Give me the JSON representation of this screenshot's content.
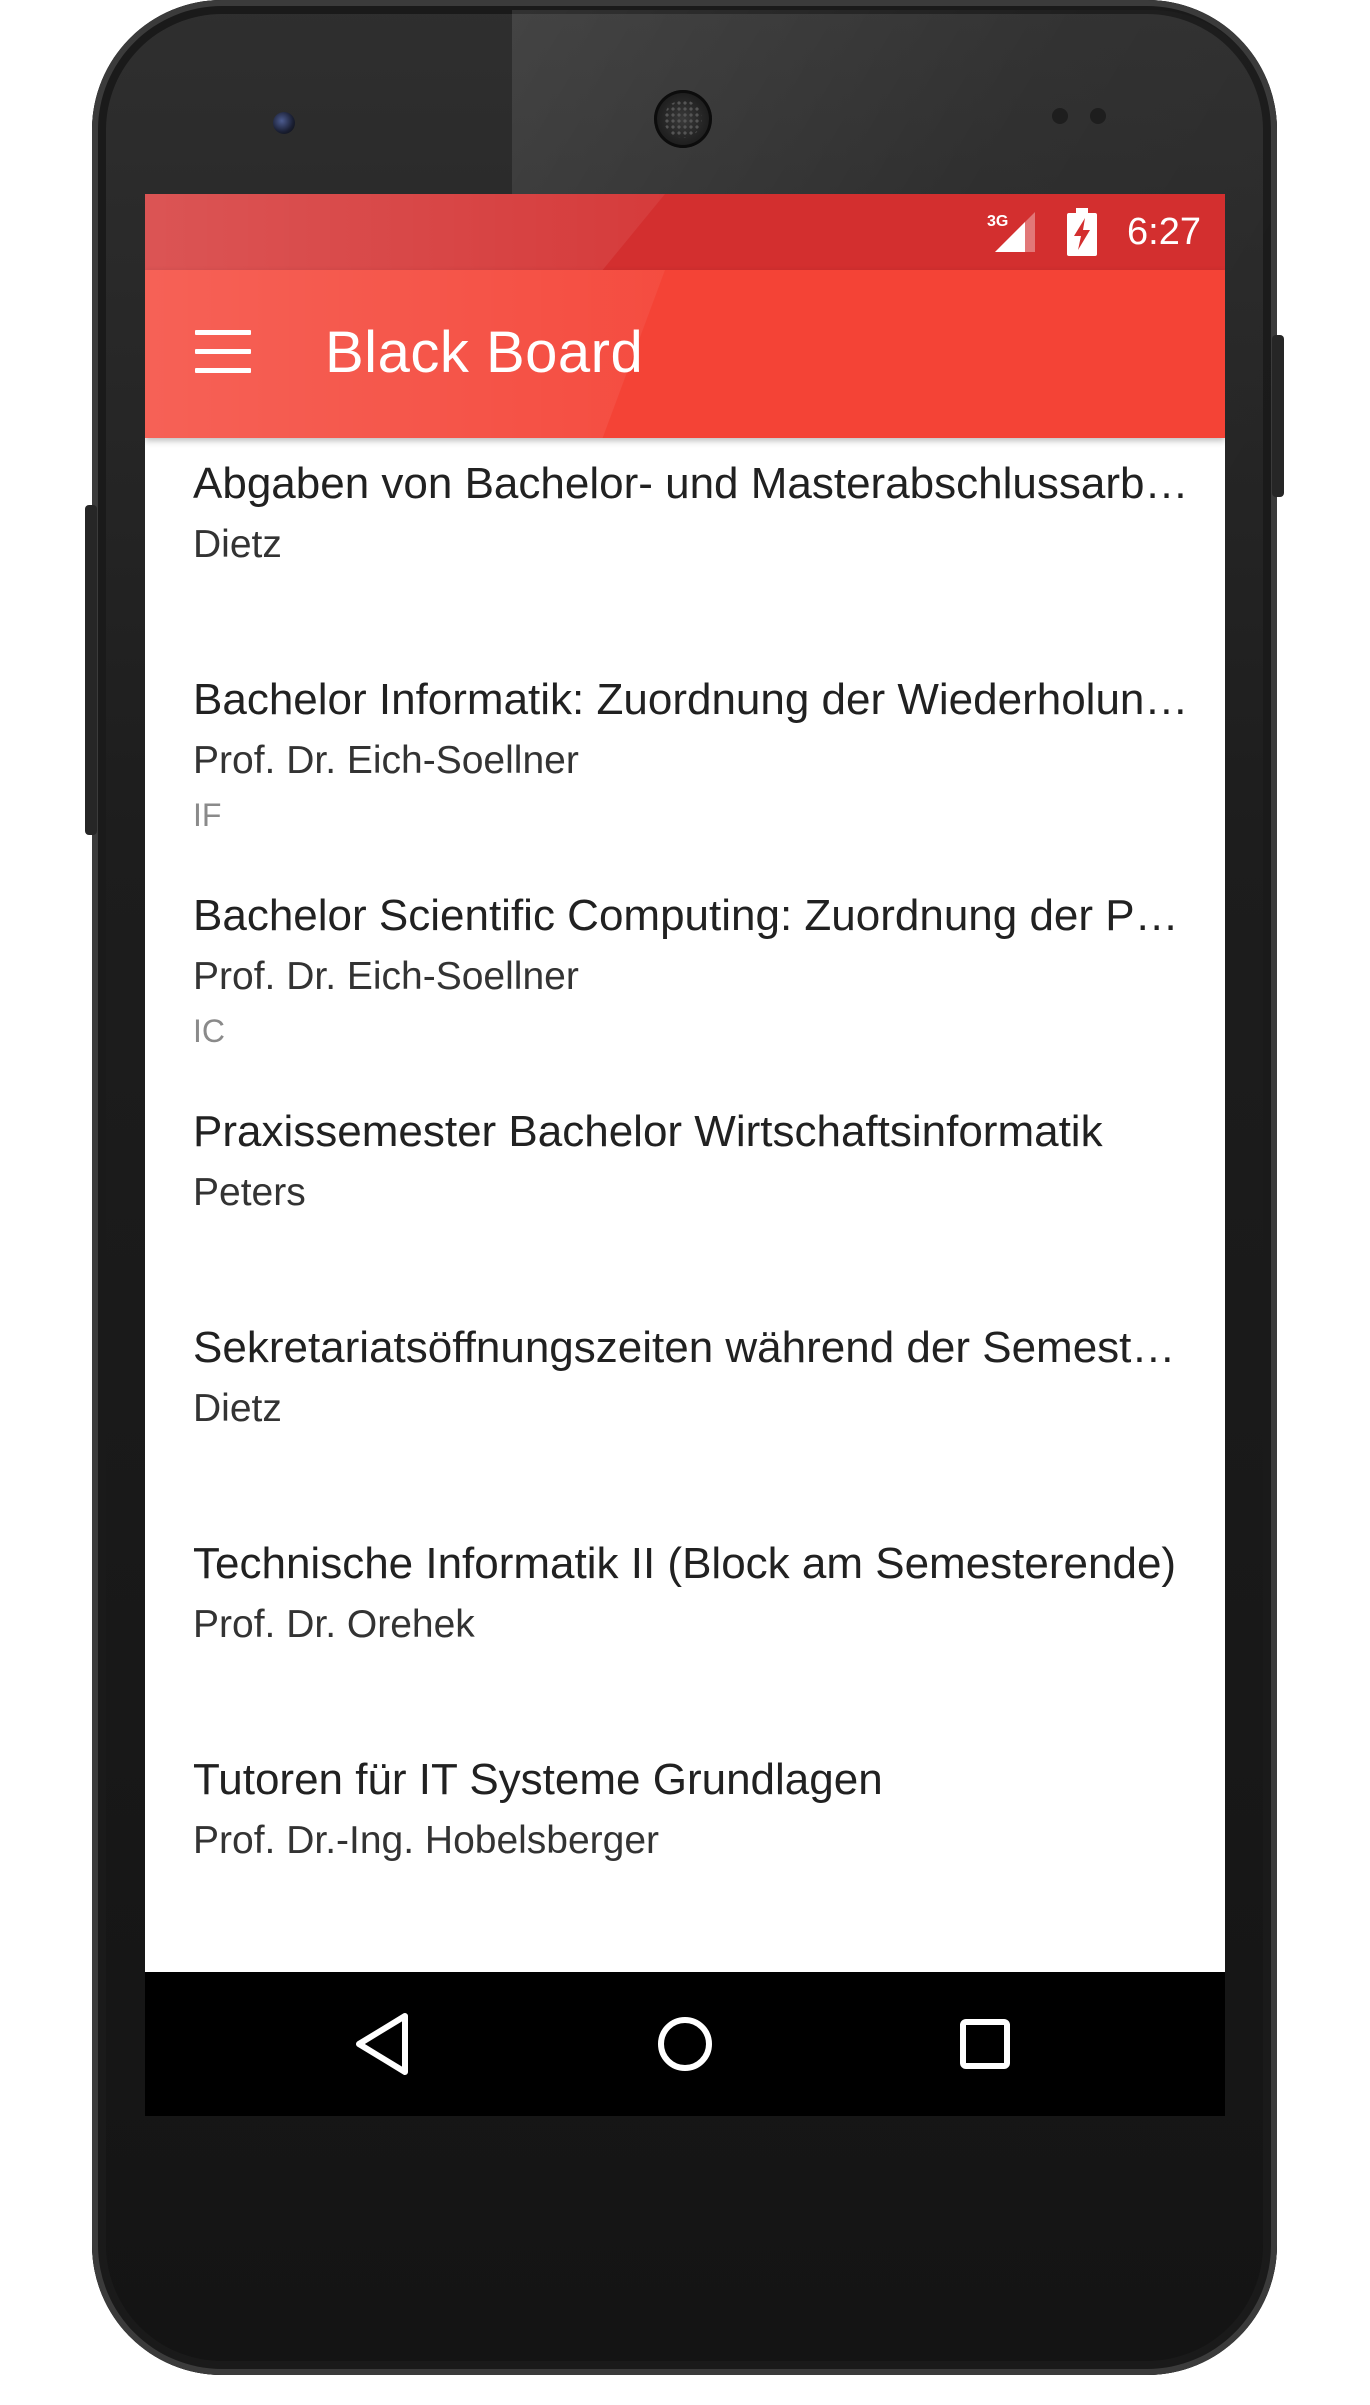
{
  "status_bar": {
    "network": "3G",
    "time": "6:27"
  },
  "app_bar": {
    "title": "Black Board",
    "menu_icon": "hamburger-menu-icon"
  },
  "posts": [
    {
      "title": "Abgaben von Bachelor- und Masterabschlussarbeiten",
      "author": "Dietz",
      "tag": ""
    },
    {
      "title": "Bachelor Informatik: Zuordnung der Wiederholungsprüfungen",
      "author": "Prof. Dr. Eich-Soellner",
      "tag": "IF"
    },
    {
      "title": "Bachelor Scientific Computing: Zuordnung der Prüfungen",
      "author": "Prof. Dr. Eich-Soellner",
      "tag": "IC"
    },
    {
      "title": "Praxissemester Bachelor Wirtschaftsinformatik",
      "author": "Peters",
      "tag": ""
    },
    {
      "title": "Sekretariatsöffnungszeiten während der Semesterferien",
      "author": "Dietz",
      "tag": ""
    },
    {
      "title": "Technische Informatik II (Block am Semesterende)",
      "author": "Prof. Dr. Orehek",
      "tag": ""
    },
    {
      "title": "Tutoren für IT Systeme Grundlagen",
      "author": "Prof. Dr.-Ing. Hobelsberger",
      "tag": ""
    }
  ],
  "nav_bar": {
    "buttons": [
      "back-icon",
      "home-icon",
      "recents-icon"
    ]
  },
  "colors": {
    "status_bar": "#d32f2f",
    "app_bar": "#f44336",
    "text_primary": "#212121",
    "text_tag": "#8a8a8a"
  }
}
